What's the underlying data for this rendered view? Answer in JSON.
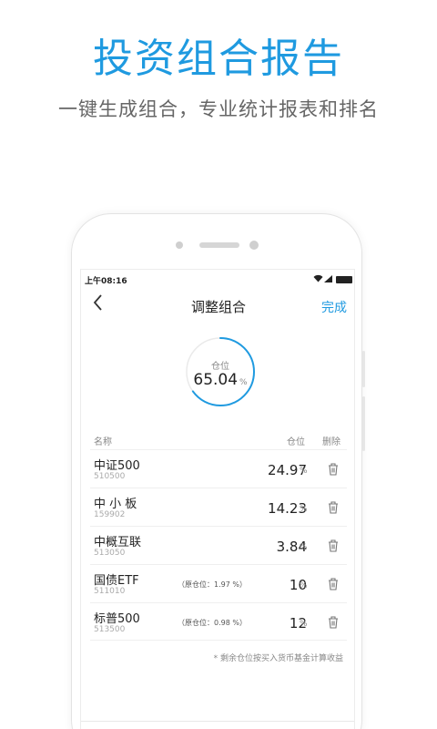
{
  "promo": {
    "title": "投资组合报告",
    "subtitle": "一键生成组合，专业统计报表和排名"
  },
  "status": {
    "time": "上午08:16",
    "wifi": "wifi-icon",
    "signal": "signal-icon",
    "battery": "battery-icon"
  },
  "nav": {
    "title": "调整组合",
    "done_label": "完成",
    "back_icon": "back-chevron-icon"
  },
  "gauge": {
    "label": "仓位",
    "value": "65.04",
    "unit": "%",
    "fraction": 0.6504,
    "accent": "#1f9ae0"
  },
  "columns": {
    "name": "名称",
    "position": "仓位",
    "delete": "删除"
  },
  "rows": [
    {
      "name": "中证500",
      "code": "510500",
      "orig": "",
      "value": "24.97",
      "unit": "%"
    },
    {
      "name": "中 小 板",
      "code": "159902",
      "orig": "",
      "value": "14.23",
      "unit": "%"
    },
    {
      "name": "中概互联",
      "code": "513050",
      "orig": "",
      "value": "3.84",
      "unit": "%"
    },
    {
      "name": "国债ETF",
      "code": "511010",
      "orig": "（原仓位：1.97 %）",
      "value": "10",
      "unit": "%"
    },
    {
      "name": "标普500",
      "code": "513500",
      "orig": "（原仓位：0.98 %）",
      "value": "12",
      "unit": "%"
    }
  ],
  "footnote": "* 剩余仓位按买入货币基金计算收益"
}
